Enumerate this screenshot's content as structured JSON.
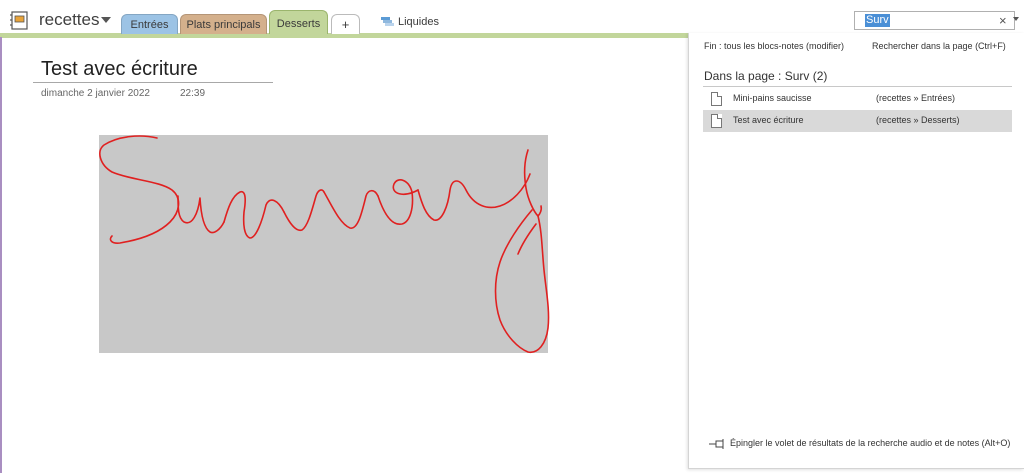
{
  "notebook": {
    "name": "recettes"
  },
  "tabs": [
    {
      "label": "Entrées",
      "color": "#9cc3e5"
    },
    {
      "label": "Plats principals",
      "color": "#d4b08c"
    },
    {
      "label": "Desserts",
      "color": "#c2d69b",
      "active": true
    },
    {
      "label": "+"
    }
  ],
  "extra_section": {
    "label": "Liquides"
  },
  "search": {
    "query": "Surv",
    "clear_glyph": "×"
  },
  "page": {
    "title": "Test avec écriture",
    "date": "dimanche 2 janvier 2022",
    "time": "22:39",
    "ink_text": "Survey",
    "ink_color": "#e02020"
  },
  "results_pane": {
    "scope_link": "Fin : tous les blocs-notes (modifier)",
    "page_search_link": "Rechercher dans la page (Ctrl+F)",
    "heading": "Dans la page : Surv (2)",
    "results": [
      {
        "title": "Mini-pains saucisse",
        "location": "(recettes » Entrées)"
      },
      {
        "title": "Test avec écriture",
        "location": "(recettes » Desserts)",
        "selected": true
      }
    ],
    "pin_label": "Épingler le volet de résultats de la recherche audio et de notes (Alt+O)"
  }
}
